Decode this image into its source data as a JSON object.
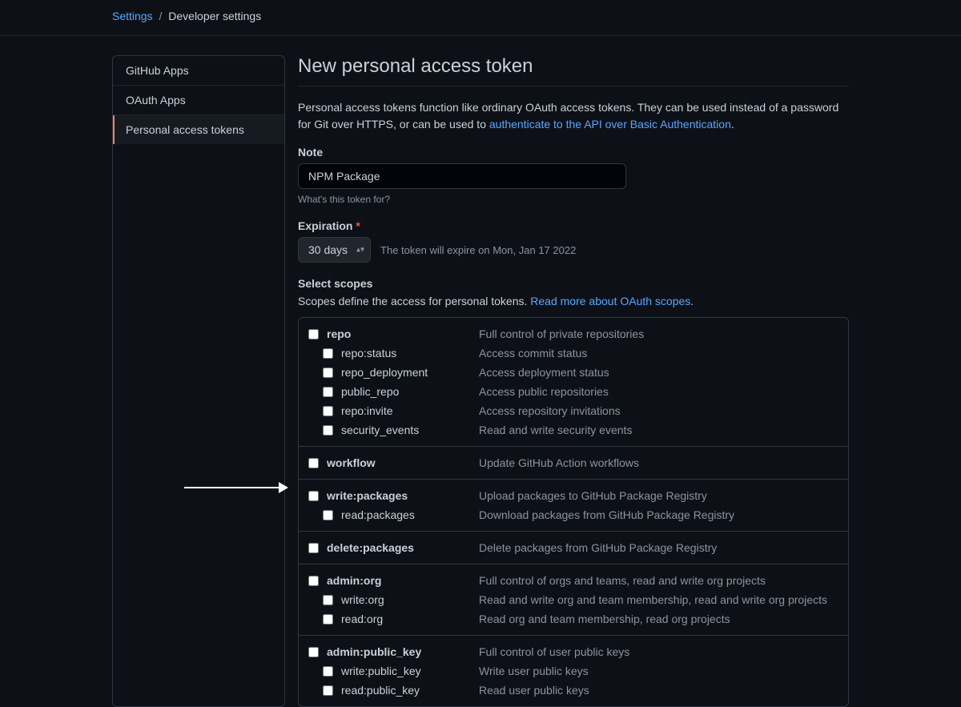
{
  "breadcrumb": {
    "settings": "Settings",
    "current": "Developer settings"
  },
  "sidebar": {
    "items": [
      {
        "label": "GitHub Apps"
      },
      {
        "label": "OAuth Apps"
      },
      {
        "label": "Personal access tokens"
      }
    ]
  },
  "page": {
    "title": "New personal access token",
    "desc1": "Personal access tokens function like ordinary OAuth access tokens. They can be used instead of a password for Git over HTTPS, or can be used to ",
    "desc_link": "authenticate to the API over Basic Authentication",
    "note_label": "Note",
    "note_value": "NPM Package",
    "note_hint": "What's this token for?",
    "exp_label": "Expiration",
    "exp_value": "30 days",
    "exp_text": "The token will expire on Mon, Jan 17 2022",
    "scopes_label": "Select scopes",
    "scopes_desc": "Scopes define the access for personal tokens. ",
    "scopes_link": "Read more about OAuth scopes"
  },
  "scopes": [
    {
      "name": "repo",
      "desc": "Full control of private repositories",
      "children": [
        {
          "name": "repo:status",
          "desc": "Access commit status"
        },
        {
          "name": "repo_deployment",
          "desc": "Access deployment status"
        },
        {
          "name": "public_repo",
          "desc": "Access public repositories"
        },
        {
          "name": "repo:invite",
          "desc": "Access repository invitations"
        },
        {
          "name": "security_events",
          "desc": "Read and write security events"
        }
      ]
    },
    {
      "name": "workflow",
      "desc": "Update GitHub Action workflows",
      "children": []
    },
    {
      "name": "write:packages",
      "desc": "Upload packages to GitHub Package Registry",
      "children": [
        {
          "name": "read:packages",
          "desc": "Download packages from GitHub Package Registry"
        }
      ]
    },
    {
      "name": "delete:packages",
      "desc": "Delete packages from GitHub Package Registry",
      "children": []
    },
    {
      "name": "admin:org",
      "desc": "Full control of orgs and teams, read and write org projects",
      "children": [
        {
          "name": "write:org",
          "desc": "Read and write org and team membership, read and write org projects"
        },
        {
          "name": "read:org",
          "desc": "Read org and team membership, read org projects"
        }
      ]
    },
    {
      "name": "admin:public_key",
      "desc": "Full control of user public keys",
      "children": [
        {
          "name": "write:public_key",
          "desc": "Write user public keys"
        },
        {
          "name": "read:public_key",
          "desc": "Read user public keys"
        }
      ]
    }
  ]
}
